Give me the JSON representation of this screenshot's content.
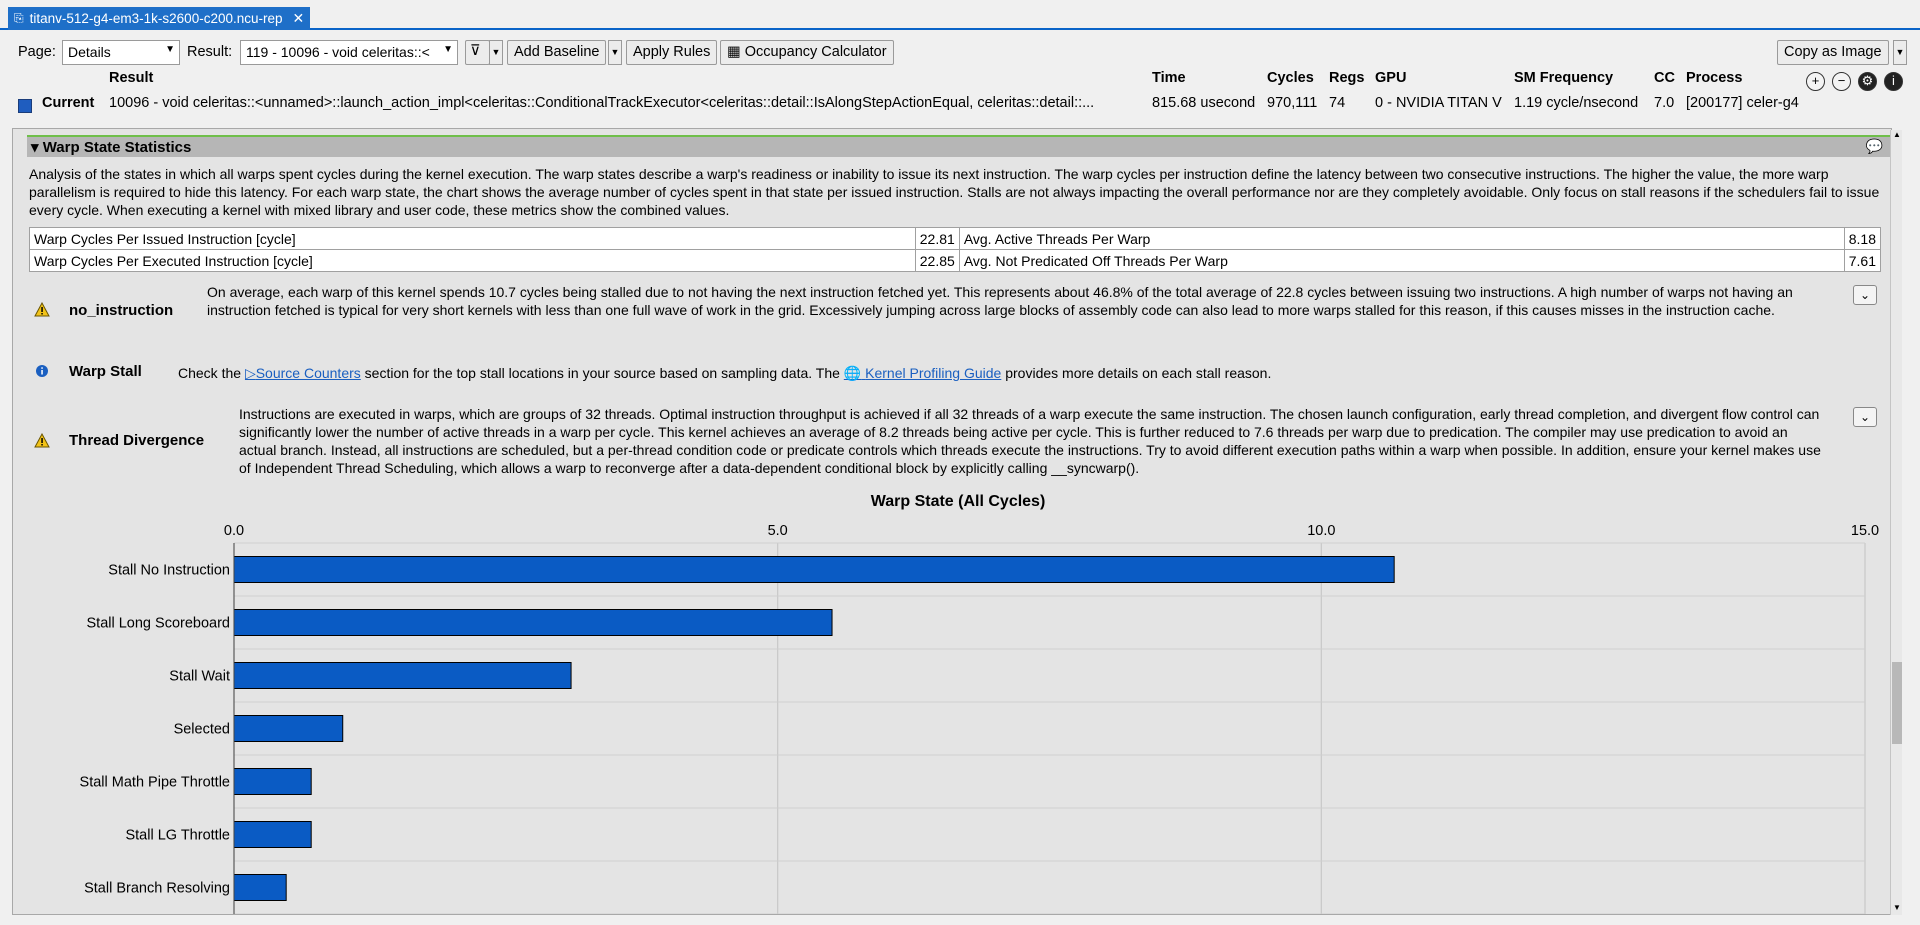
{
  "tab": {
    "title": "titanv-512-g4-em3-1k-s2600-c200.ncu-rep",
    "close": "✕"
  },
  "toolbar": {
    "page_label": "Page:",
    "page_value": "Details",
    "result_label": "Result:",
    "result_value": "119 - 10096 - void celeritas::<",
    "add_baseline": "Add Baseline",
    "apply_rules": "Apply Rules",
    "occupancy_calculator": "Occupancy Calculator",
    "copy_as_image": "Copy as Image"
  },
  "result_header": {
    "columns": {
      "result": "Result",
      "time": "Time",
      "cycles": "Cycles",
      "regs": "Regs",
      "gpu": "GPU",
      "sm_frequency": "SM Frequency",
      "cc": "CC",
      "process": "Process"
    },
    "current_label": "Current",
    "name": "10096 - void celeritas::<unnamed>::launch_action_impl<celeritas::ConditionalTrackExecutor<celeritas::detail::IsAlongStepActionEqual, celeritas::detail::...",
    "time": "815.68 usecond",
    "cycles": "970,111",
    "regs": "74",
    "gpu": "0 - NVIDIA TITAN V",
    "sm_frequency": "1.19 cycle/nsecond",
    "cc": "7.0",
    "process": "[200177] celer-g4"
  },
  "section": {
    "title": "Warp State Statistics",
    "description": "Analysis of the states in which all warps spent cycles during the kernel execution. The warp states describe a warp's readiness or inability to issue its next instruction. The warp cycles per instruction define the latency between two consecutive instructions. The higher the value, the more warp parallelism is required to hide this latency. For each warp state, the chart shows the average number of cycles spent in that state per issued instruction. Stalls are not always impacting the overall performance nor are they completely avoidable. Only focus on stall reasons if the schedulers fail to issue every cycle. When executing a kernel with mixed library and user code, these metrics show the combined values."
  },
  "metrics": [
    {
      "label": "Warp Cycles Per Issued Instruction [cycle]",
      "value": "22.81",
      "label2": "Avg. Active Threads Per Warp",
      "value2": "8.18"
    },
    {
      "label": "Warp Cycles Per Executed Instruction [cycle]",
      "value": "22.85",
      "label2": "Avg. Not Predicated Off Threads Per Warp",
      "value2": "7.61"
    }
  ],
  "rules": {
    "no_instruction": {
      "title": "no_instruction",
      "body": "On average, each warp of this kernel spends 10.7 cycles being stalled due to not having the next instruction fetched yet. This represents about 46.8% of the total average of 22.8 cycles between issuing two instructions. A high number of warps not having an instruction fetched is typical for very short kernels with less than one full wave of work in the grid. Excessively jumping across large blocks of assembly code can also lead to more warps stalled for this reason, if this causes misses in the instruction cache."
    },
    "warp_stall": {
      "title": "Warp Stall",
      "pre": "Check the",
      "link1": "Source Counters",
      "mid": "section for the top stall locations in your source based on sampling data. The",
      "link2": "Kernel Profiling Guide",
      "post": "provides more details on each stall reason."
    },
    "thread_divergence": {
      "title": "Thread Divergence",
      "body": "Instructions are executed in warps, which are groups of 32 threads. Optimal instruction throughput is achieved if all 32 threads of a warp execute the same instruction. The chosen launch configuration, early thread completion, and divergent flow control can significantly lower the number of active threads in a warp per cycle. This kernel achieves an average of 8.2 threads being active per cycle. This is further reduced to 7.6 threads per warp due to predication. The compiler may use predication to avoid an actual branch. Instead, all instructions are scheduled, but a per-thread condition code or predicate controls which threads execute the instructions. Try to avoid different execution paths within a warp when possible. In addition, ensure your kernel makes use of Independent Thread Scheduling, which allows a warp to reconverge after a data-dependent conditional block by explicitly calling __syncwarp()."
    }
  },
  "colors": {
    "bar": "#0a5bc4",
    "accent": "#1e6fc8"
  },
  "chart_data": {
    "type": "bar",
    "orientation": "horizontal",
    "title": "Warp State (All Cycles)",
    "xlim": [
      0,
      15
    ],
    "ticks": [
      "0.0",
      "5.0",
      "10.0",
      "15.0"
    ],
    "tick_values": [
      0,
      5,
      10,
      15
    ],
    "categories": [
      "Stall No Instruction",
      "Stall Long Scoreboard",
      "Stall Wait",
      "Selected",
      "Stall Math Pipe Throttle",
      "Stall LG Throttle",
      "Stall Branch Resolving"
    ],
    "values": [
      10.67,
      5.5,
      3.1,
      1.0,
      0.71,
      0.71,
      0.48
    ],
    "grid": true
  }
}
